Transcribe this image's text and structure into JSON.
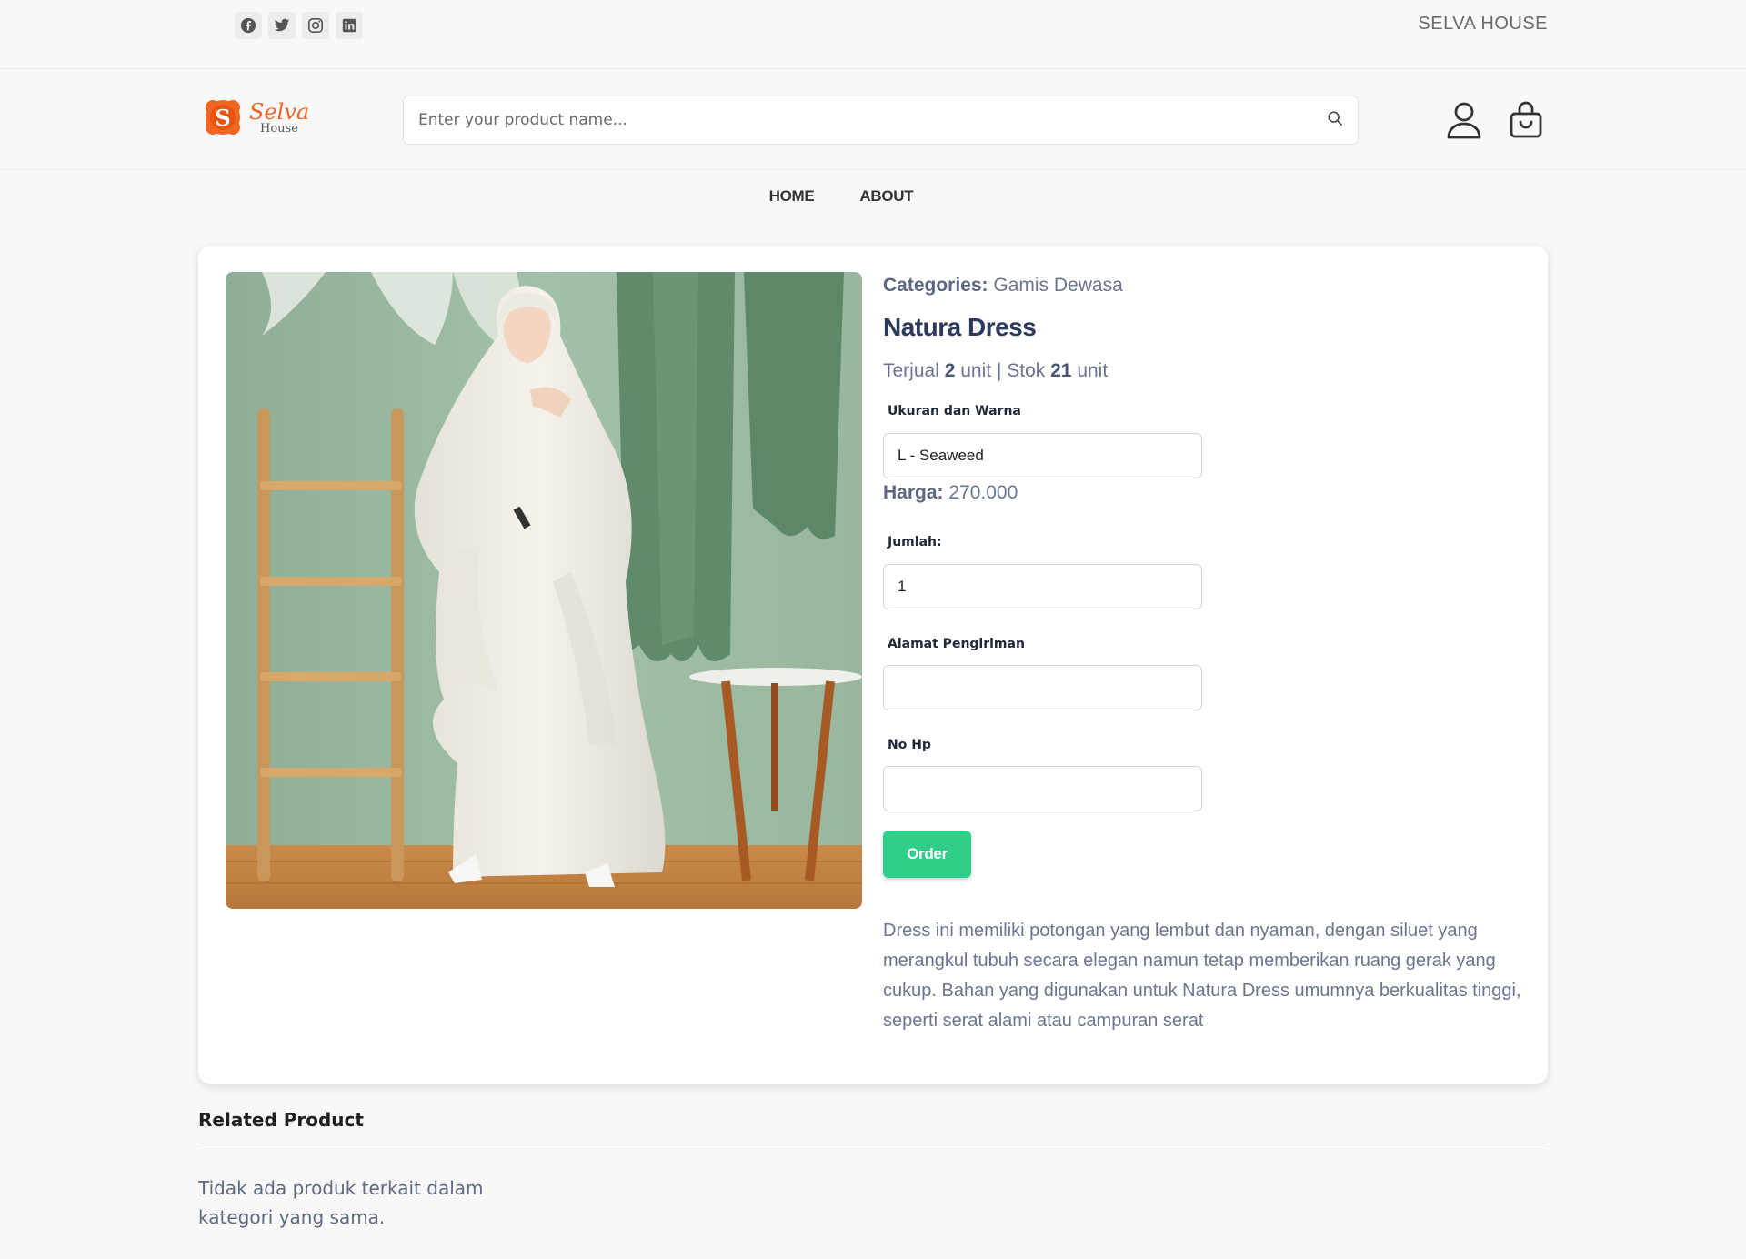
{
  "topbar": {
    "social_icons": [
      "facebook-icon",
      "twitter-icon",
      "instagram-icon",
      "linkedin-icon"
    ],
    "brand": "SELVA HOUSE"
  },
  "header": {
    "logo_text": "Selva",
    "logo_subtext": "House",
    "search_placeholder": "Enter your product name..."
  },
  "nav": {
    "home": "HOME",
    "about": "ABOUT"
  },
  "product": {
    "categories_label": "Categories:",
    "category": "Gamis Dewasa",
    "name": "Natura Dress",
    "sold_prefix": "Terjual",
    "sold_count": "2",
    "sold_unit": "unit | Stok",
    "stock_count": "21",
    "stock_unit": "unit",
    "variant_label": "Ukuran dan Warna",
    "variant_value": "L - Seaweed",
    "price_label": "Harga:",
    "price": "270.000",
    "qty_label": "Jumlah:",
    "qty_value": "1",
    "address_label": "Alamat Pengiriman",
    "address_value": "",
    "phone_label": "No Hp",
    "phone_value": "",
    "order_button": "Order",
    "description": "Dress ini memiliki potongan yang lembut dan nyaman, dengan siluet yang merangkul tubuh secara elegan namun tetap memberikan ruang gerak yang cukup. Bahan yang digunakan untuk Natura Dress umumnya berkualitas tinggi, seperti serat alami atau campuran serat"
  },
  "related": {
    "title": "Related Product",
    "empty_text": "Tidak ada produk terkait dalam kategori yang sama."
  },
  "colors": {
    "accent": "#2fcf8a",
    "logo_orange": "#f26522",
    "text_muted": "#6b7592",
    "title": "#2b3a5c"
  }
}
